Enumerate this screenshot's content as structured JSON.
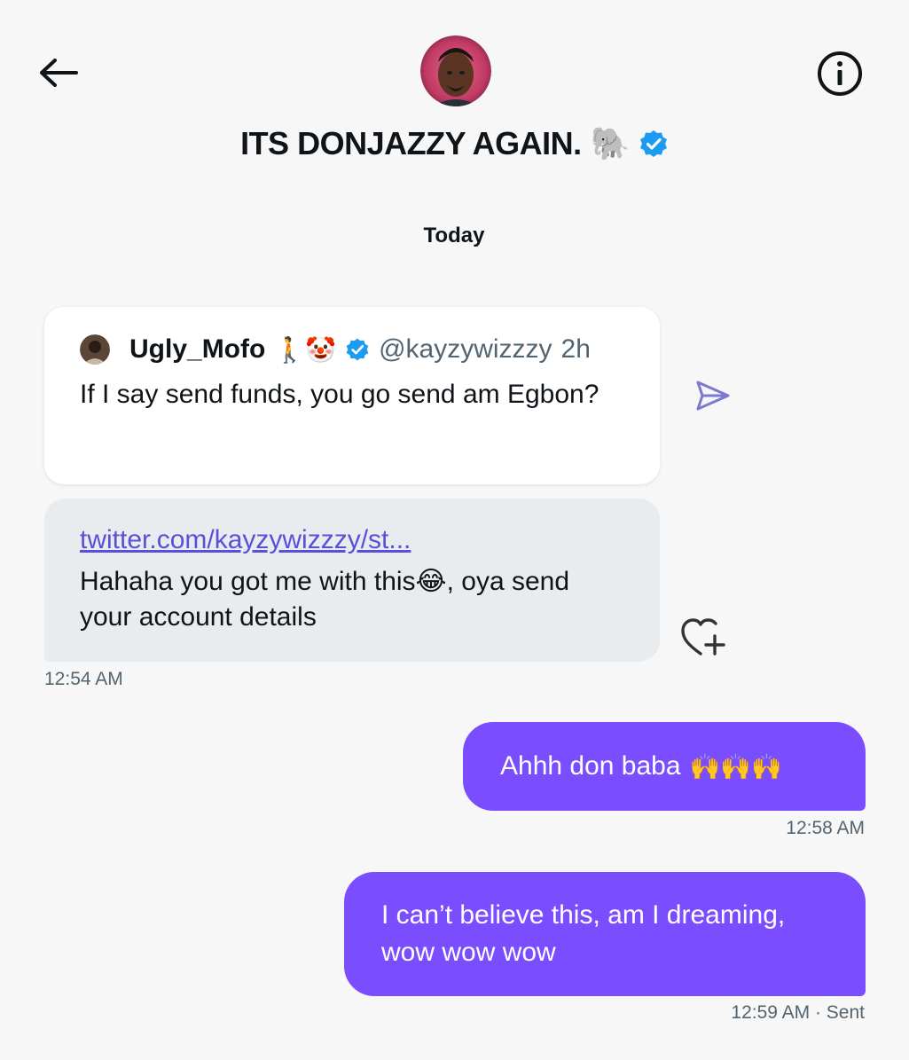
{
  "header": {
    "title": "ITS DONJAZZY AGAIN.",
    "title_emoji": "🐘",
    "back_icon": "arrow-left-icon",
    "info_icon": "info-icon",
    "verified_icon": "verified-badge-icon"
  },
  "day_separator": "Today",
  "quoted_tweet": {
    "display_name": "Ugly_Mofo",
    "name_emojis": "🚶🤡",
    "handle": "@kayzywizzzy",
    "time": "2h",
    "text": "If I say send funds, you go send am Egbon?"
  },
  "received_message": {
    "link": "twitter.com/kayzywizzzy/st...",
    "text_before_emoji": "Hahaha you got me with this",
    "emoji": "😂",
    "text_after_emoji": ", oya send your account details",
    "timestamp": "12:54 AM"
  },
  "sent_messages": [
    {
      "text": "Ahhh don baba",
      "emoji": "🙌🙌🙌",
      "timestamp": "12:58 AM"
    },
    {
      "text": "I can’t believe this, am I dreaming, wow wow wow",
      "timestamp": "12:59 AM · Sent"
    }
  ],
  "colors": {
    "accent": "#7a4dff",
    "verified": "#1d9bf0",
    "received_bubble": "#e9ecee",
    "background": "#f7f7f7"
  }
}
